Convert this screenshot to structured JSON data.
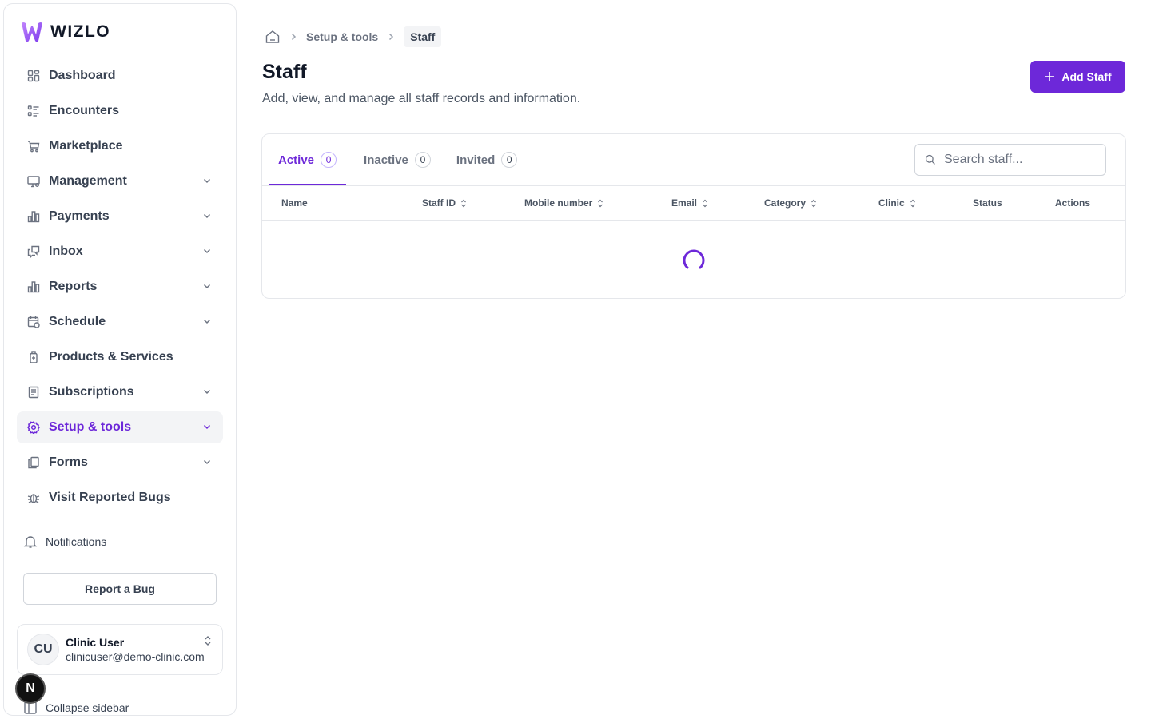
{
  "brand": {
    "name": "WIZLO",
    "accent": "#6d28d9"
  },
  "sidebar": {
    "items": [
      {
        "label": "Dashboard",
        "icon": "grid-icon",
        "has_chevron": false
      },
      {
        "label": "Encounters",
        "icon": "list-icon",
        "has_chevron": false
      },
      {
        "label": "Marketplace",
        "icon": "cart-icon",
        "has_chevron": false
      },
      {
        "label": "Management",
        "icon": "monitor-gear-icon",
        "has_chevron": true
      },
      {
        "label": "Payments",
        "icon": "bar-chart-icon",
        "has_chevron": true
      },
      {
        "label": "Inbox",
        "icon": "chat-icon",
        "has_chevron": true
      },
      {
        "label": "Reports",
        "icon": "bar-chart-icon",
        "has_chevron": true
      },
      {
        "label": "Schedule",
        "icon": "calendar-clock-icon",
        "has_chevron": true
      },
      {
        "label": "Products & Services",
        "icon": "bottle-icon",
        "has_chevron": false
      },
      {
        "label": "Subscriptions",
        "icon": "receipt-icon",
        "has_chevron": true
      },
      {
        "label": "Setup & tools",
        "icon": "gear-icon",
        "has_chevron": true,
        "active": true
      },
      {
        "label": "Forms",
        "icon": "copy-icon",
        "has_chevron": true
      },
      {
        "label": "Visit Reported Bugs",
        "icon": "bug-icon",
        "has_chevron": false
      }
    ],
    "notifications_label": "Notifications",
    "report_bug_label": "Report a Bug",
    "user": {
      "initials": "CU",
      "name": "Clinic User",
      "email": "clinicuser@demo-clinic.com"
    },
    "collapse_label": "Collapse sidebar",
    "floating_badge": "N"
  },
  "breadcrumb": {
    "parent": "Setup & tools",
    "current": "Staff"
  },
  "header": {
    "title": "Staff",
    "subtitle": "Add, view, and manage all staff records and information.",
    "add_button": "Add Staff"
  },
  "tabs": [
    {
      "label": "Active",
      "count": "0",
      "active": true
    },
    {
      "label": "Inactive",
      "count": "0"
    },
    {
      "label": "Invited",
      "count": "0"
    }
  ],
  "search": {
    "placeholder": "Search staff..."
  },
  "table": {
    "columns": [
      {
        "label": "Name",
        "sortable": false
      },
      {
        "label": "Staff ID",
        "sortable": true
      },
      {
        "label": "Mobile number",
        "sortable": true
      },
      {
        "label": "Email",
        "sortable": true
      },
      {
        "label": "Category",
        "sortable": true
      },
      {
        "label": "Clinic",
        "sortable": true
      },
      {
        "label": "Status",
        "sortable": false
      },
      {
        "label": "Actions",
        "sortable": false
      }
    ],
    "loading": true
  }
}
